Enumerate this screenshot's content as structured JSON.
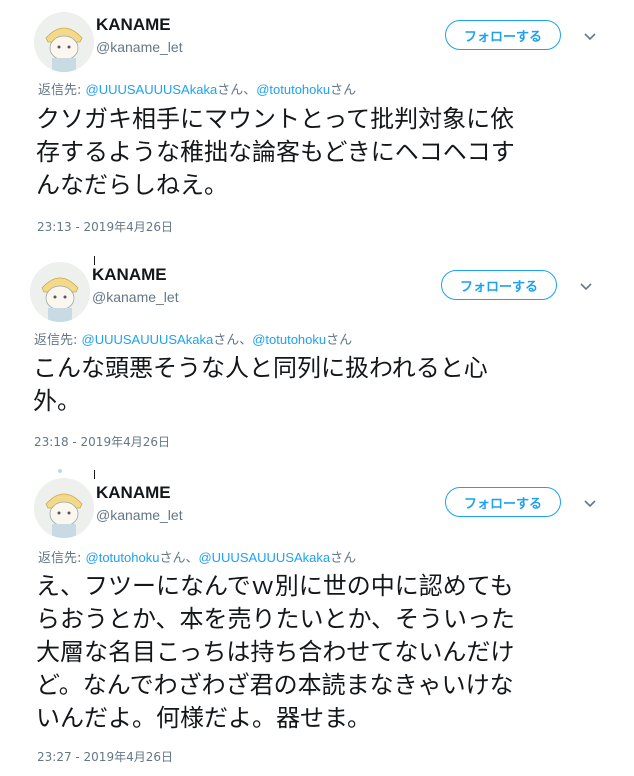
{
  "tweets": [
    {
      "name": "KANAME",
      "handle": "@kaname_let",
      "follow_label": "フォローする",
      "reply_prefix": "返信先: ",
      "reply_to": [
        "@UUUSAUUUSAkaka",
        "@totutohoku"
      ],
      "reply_suffix_1": "さん、",
      "reply_suffix_2": "さん",
      "text_lines": [
        "クソガキ相手にマウントとって批判対象に依",
        "存するような稚拙な論客もどきにヘコヘコす",
        "んなだらしねえ。"
      ],
      "timestamp": "23:13 - 2019年4月26日"
    },
    {
      "name": "KANAME",
      "handle": "@kaname_let",
      "follow_label": "フォローする",
      "reply_prefix": "返信先: ",
      "reply_to": [
        "@UUUSAUUUSAkaka",
        "@totutohoku"
      ],
      "reply_suffix_1": "さん、",
      "reply_suffix_2": "さん",
      "text_lines": [
        "こんな頭悪そうな人と同列に扱われると心",
        "外。"
      ],
      "timestamp": "23:18 - 2019年4月26日"
    },
    {
      "name": "KANAME",
      "handle": "@kaname_let",
      "follow_label": "フォローする",
      "reply_prefix": "返信先: ",
      "reply_to": [
        "@totutohoku",
        "@UUUSAUUUSAkaka"
      ],
      "reply_suffix_1": "さん、",
      "reply_suffix_2": "さん",
      "text_lines": [
        "え、フツーになんでｗ別に世の中に認めても",
        "らおうとか、本を売りたいとか、そういった",
        "大層な名目こっちは持ち合わせてないんだけ",
        "ど。なんでわざわざ君の本読まなきゃいけな",
        "いんだよ。何様だよ。器せま。"
      ],
      "timestamp": "23:27 - 2019年4月26日"
    }
  ],
  "icons": {
    "avatar": "avatar-illustration",
    "caret": "chevron-down-icon"
  },
  "colors": {
    "accent": "#1da1f2",
    "secondary_text": "#657786",
    "text": "#14171a"
  }
}
